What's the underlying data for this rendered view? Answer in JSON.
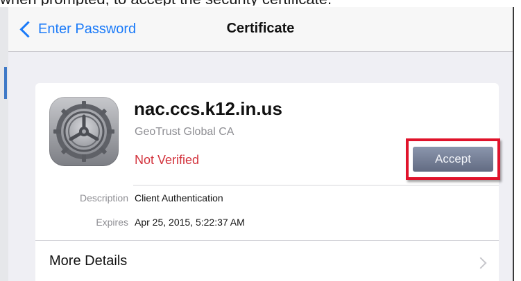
{
  "caption": "when prompted, to accept the security certificate.",
  "nav": {
    "back_label": "Enter Password",
    "title": "Certificate"
  },
  "certificate": {
    "host": "nac.ccs.k12.in.us",
    "issuer": "GeoTrust Global CA",
    "status": "Not Verified",
    "accept_label": "Accept",
    "details": [
      {
        "label": "Description",
        "value": "Client Authentication"
      },
      {
        "label": "Expires",
        "value": "Apr 25, 2015, 5:22:37 AM"
      }
    ],
    "more_label": "More Details"
  },
  "colors": {
    "link": "#1a7af8",
    "status_red": "#d3333d",
    "highlight_red": "#e0132b"
  },
  "icons": {
    "app": "settings-gear-icon",
    "back": "chevron-left-icon",
    "disclosure": "chevron-right-icon"
  }
}
